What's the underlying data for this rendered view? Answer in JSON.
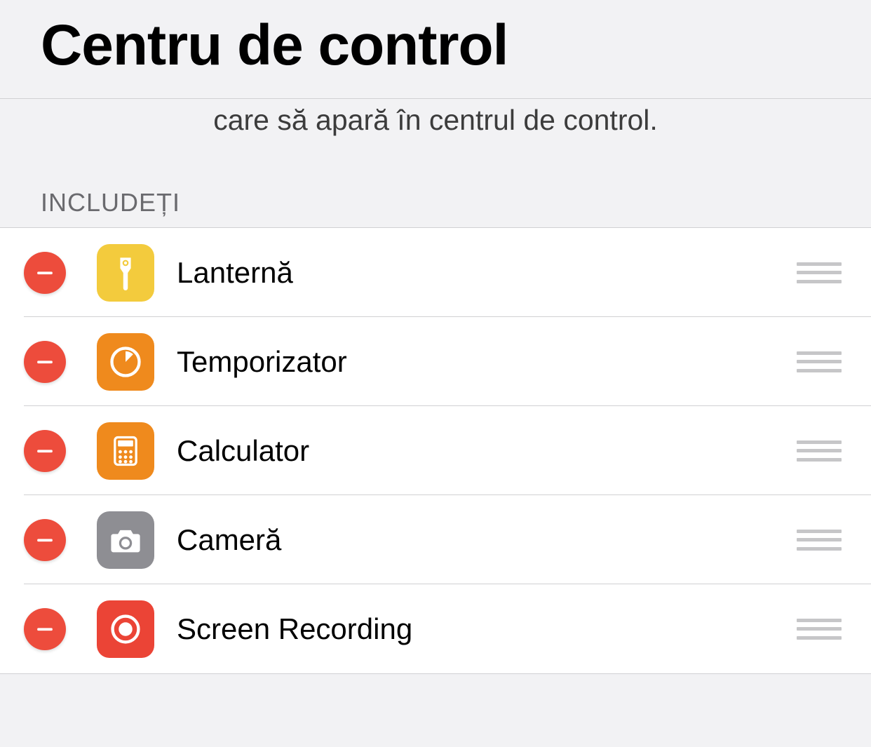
{
  "header": {
    "title": "Centru de control"
  },
  "description": "care să apară în centrul de control.",
  "section": {
    "title": "INCLUDEȚI"
  },
  "colors": {
    "flashlight": "#f3cb3d",
    "timer": "#ef8a1d",
    "calculator": "#ef8a1d",
    "camera": "#8e8e93",
    "recording": "#eb4436"
  },
  "items": [
    {
      "label": "Lanternă",
      "icon": "flashlight"
    },
    {
      "label": "Temporizator",
      "icon": "timer"
    },
    {
      "label": "Calculator",
      "icon": "calculator"
    },
    {
      "label": "Cameră",
      "icon": "camera"
    },
    {
      "label": "Screen Recording",
      "icon": "recording"
    }
  ]
}
